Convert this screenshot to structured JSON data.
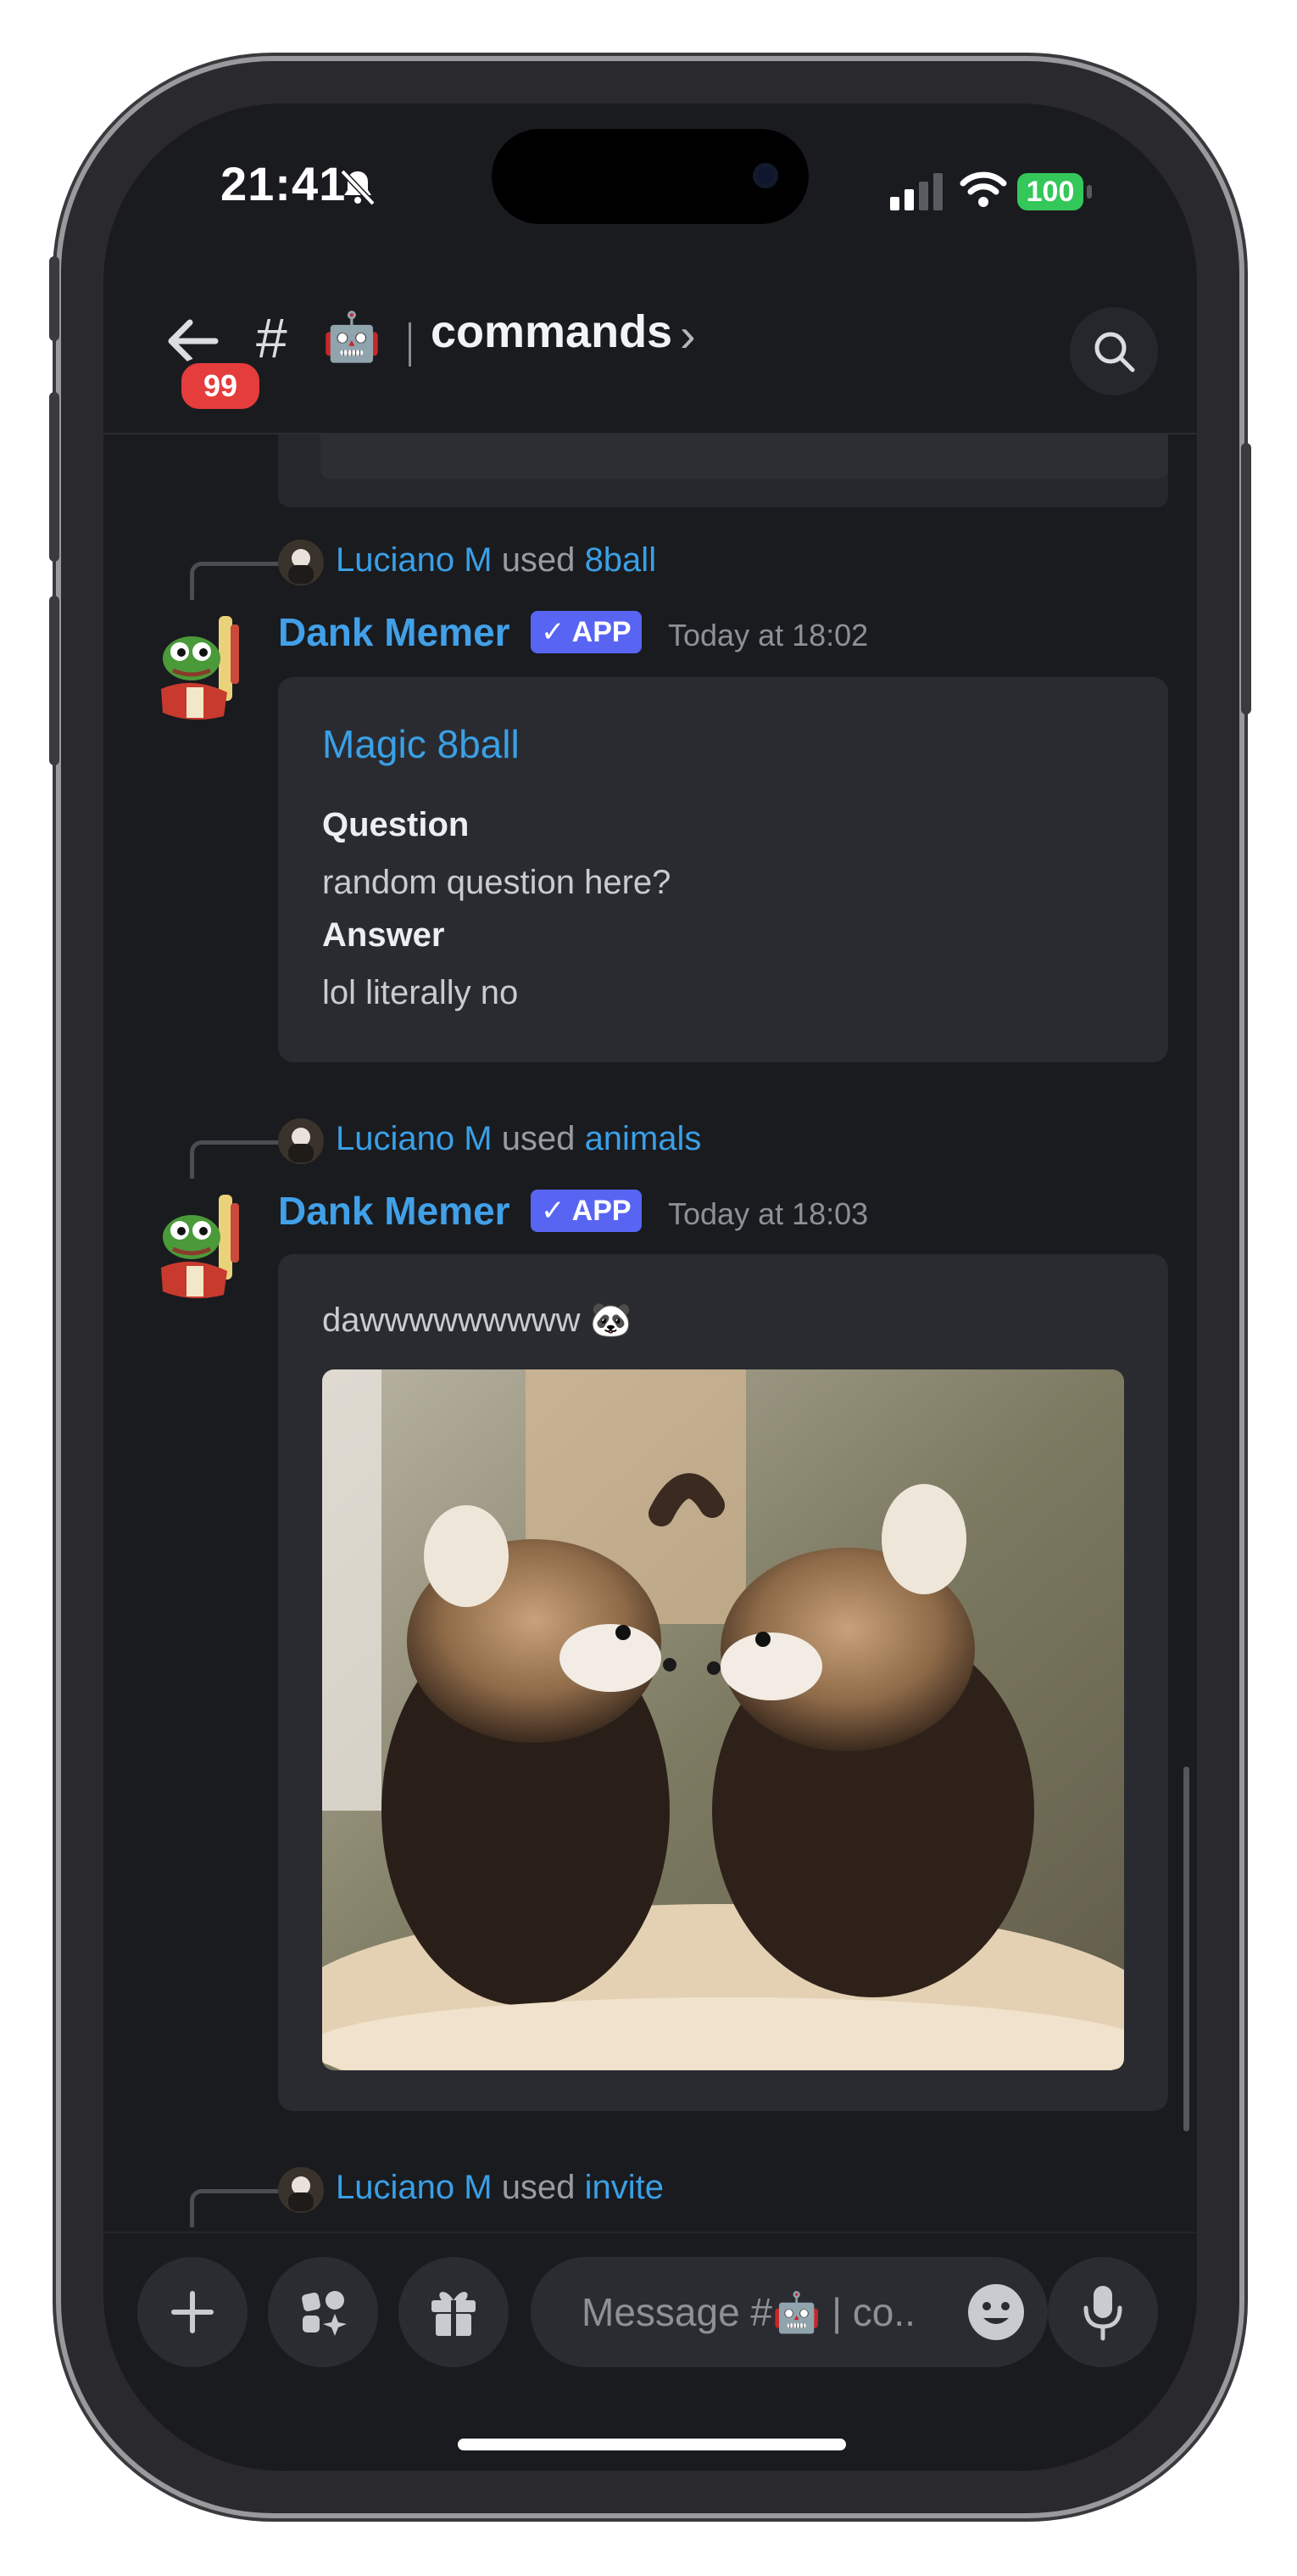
{
  "status_bar": {
    "time": "21:41",
    "battery": "100"
  },
  "header": {
    "notification_count": "99",
    "hash": "#",
    "channel_emoji": "🤖",
    "channel_name": "commands",
    "chevron": "›"
  },
  "messages": [
    {
      "reply": {
        "user": "Luciano M",
        "verb": "used",
        "command": "8ball"
      },
      "author": "Dank Memer",
      "badge": "✓ APP",
      "timestamp": "Today at 18:02",
      "embed": {
        "title": "Magic 8ball",
        "fields": [
          {
            "name": "Question",
            "value": "random question here?"
          },
          {
            "name": "Answer",
            "value": "lol literally no"
          }
        ]
      }
    },
    {
      "reply": {
        "user": "Luciano M",
        "verb": "used",
        "command": "animals"
      },
      "author": "Dank Memer",
      "badge": "✓ APP",
      "timestamp": "Today at 18:03",
      "embed": {
        "description": "dawwwwwwwww 🐼",
        "image_alt": "two red pandas"
      }
    },
    {
      "reply": {
        "user": "Luciano M",
        "verb": "used",
        "command": "invite"
      }
    }
  ],
  "composer": {
    "placeholder": "Message #🤖 | co.."
  },
  "icons": [
    "back-arrow-icon",
    "search-icon",
    "plus-icon",
    "apps-icon",
    "gift-icon",
    "emoji-icon",
    "microphone-icon",
    "bell-slash-icon",
    "signal-icon",
    "wifi-icon"
  ],
  "colors": {
    "background": "#1a1b1f",
    "link": "#3aa0e6",
    "app_badge": "#5865f2",
    "badge_red": "#e53c3c",
    "battery": "#34c759"
  }
}
